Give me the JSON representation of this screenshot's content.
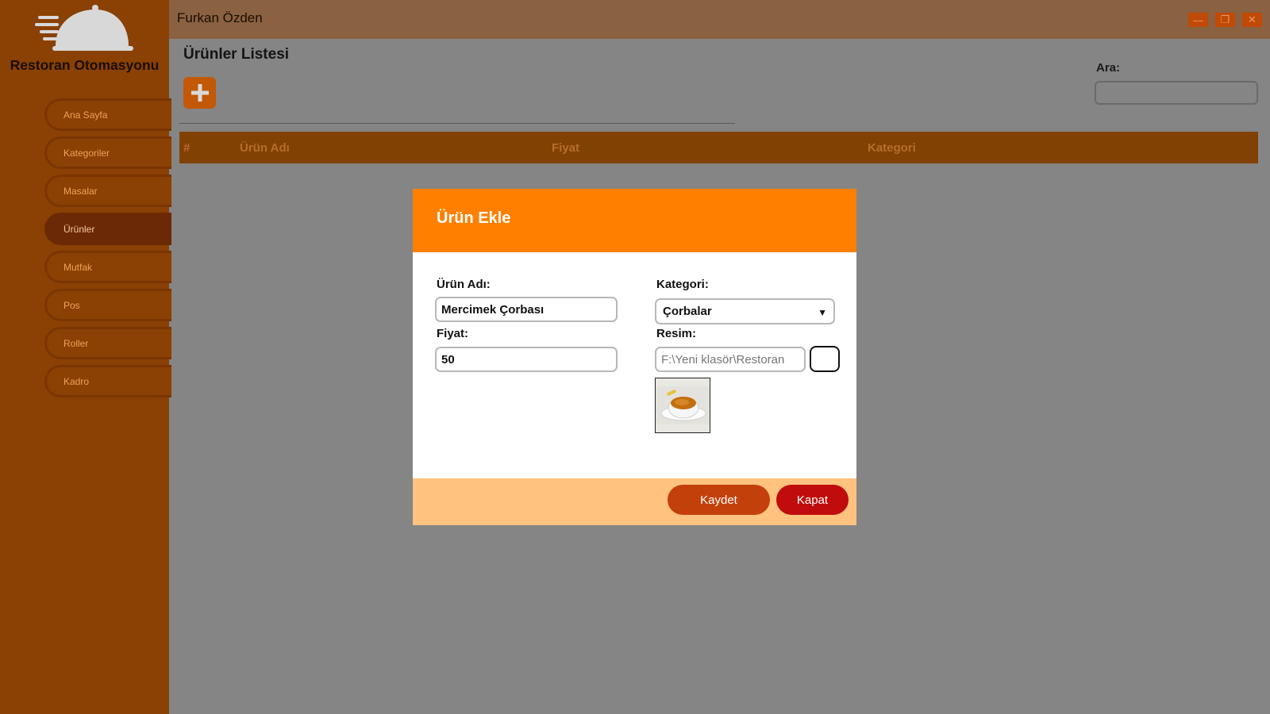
{
  "app": {
    "name": "Restoran Otomasyonu",
    "user": "Furkan Özden"
  },
  "sidebar": {
    "items": [
      {
        "label": "Ana Sayfa",
        "active": false
      },
      {
        "label": "Kategoriler",
        "active": false
      },
      {
        "label": "Masalar",
        "active": false
      },
      {
        "label": "Ürünler",
        "active": true
      },
      {
        "label": "Mutfak",
        "active": false
      },
      {
        "label": "Pos",
        "active": false
      },
      {
        "label": "Roller",
        "active": false
      },
      {
        "label": "Kadro",
        "active": false
      }
    ]
  },
  "window_controls": {
    "minimize": "—",
    "maximize": "❐",
    "close": "✕"
  },
  "page": {
    "title": "Ürünler Listesi",
    "add_icon": "plus-icon",
    "search_label": "Ara:",
    "search_value": "",
    "table_headers": [
      "#",
      "Ürün Adı",
      "Fiyat",
      "Kategori"
    ]
  },
  "modal": {
    "title": "Ürün Ekle",
    "name_label": "Ürün Adı:",
    "name_value": "Mercimek Çorbası",
    "price_label": "Fiyat:",
    "price_value": "50",
    "category_label": "Kategori:",
    "category_value": "Çorbalar",
    "image_label": "Resim:",
    "image_path": "F:\\Yeni klasör\\Restoran",
    "save_label": "Kaydet",
    "close_label": "Kapat"
  },
  "colors": {
    "sidebar": "#8a4103",
    "accent": "#ff8000",
    "footer": "#ffc27f",
    "save": "#c4400a",
    "close": "#c00c0c"
  }
}
